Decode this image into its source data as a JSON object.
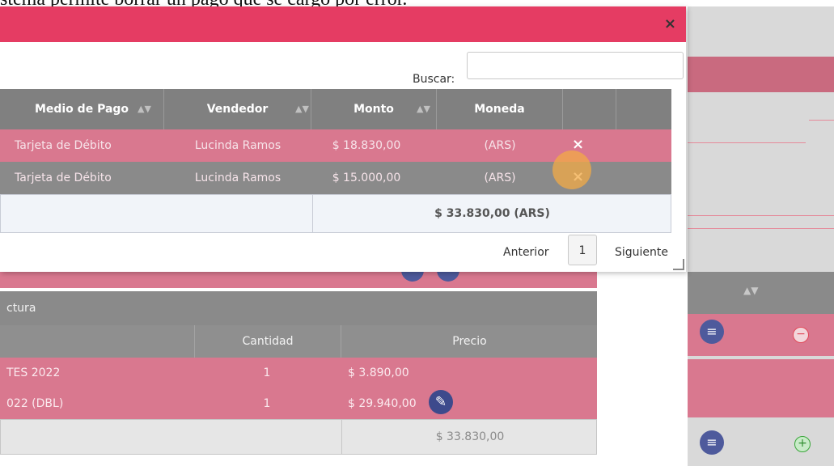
{
  "caption": "stema permite borrar un pago que se cargó por error.",
  "modal": {
    "close_icon": "×",
    "search": {
      "label": "Buscar:",
      "value": ""
    },
    "table": {
      "headers": [
        "Medio de Pago",
        "Vendedor",
        "Monto",
        "Moneda"
      ],
      "rows": [
        {
          "medio": "Tarjeta de Débito",
          "vendedor": "Lucinda Ramos",
          "monto": "$ 18.830,00",
          "moneda": "(ARS)",
          "delete": "×"
        },
        {
          "medio": "Tarjeta de Débito",
          "vendedor": "Lucinda Ramos",
          "monto": "$ 15.000,00",
          "moneda": "(ARS)",
          "delete": "×"
        }
      ],
      "total": "$ 33.830,00 (ARS)"
    },
    "pager": {
      "prev": "Anterior",
      "page": "1",
      "next": "Siguiente"
    }
  },
  "background": {
    "factura_header": "ctura",
    "columns": {
      "cantidad": "Cantidad",
      "precio": "Precio"
    },
    "rows": [
      {
        "desc": "TES 2022",
        "cantidad": "1",
        "precio": "$ 3.890,00"
      },
      {
        "desc": "022 (DBL)",
        "cantidad": "1",
        "precio": "$ 29.940,00"
      }
    ],
    "total": "$ 33.830,00",
    "icons": {
      "sort": "sort-icon",
      "list": "list-icon",
      "remove": "minus-icon",
      "add": "plus-icon",
      "edit": "edit-icon"
    }
  },
  "colors": {
    "accent": "#e53c63",
    "row_pink": "#d9788f",
    "row_gray": "#8a8a8a",
    "button_blue": "#4e5a9c"
  }
}
